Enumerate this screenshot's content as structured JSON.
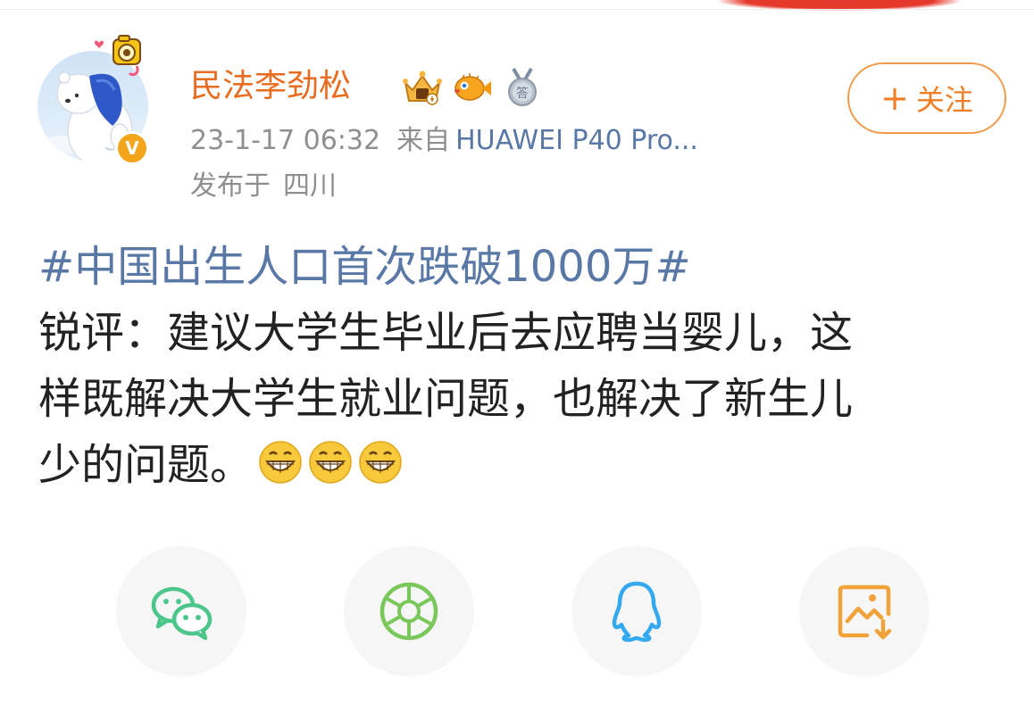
{
  "user": {
    "name": "民法李劲松",
    "verified_mark": "V",
    "badges": [
      "vip-crown-badge-icon",
      "pufferfish-badge-icon",
      "answer-medal-badge-icon"
    ]
  },
  "follow_button": {
    "plus": "+",
    "label": "关注"
  },
  "meta": {
    "timestamp": "23-1-17 06:32",
    "source_prefix": "来自",
    "source": "HUAWEI P40 Pro...",
    "location_label": "发布于",
    "location": "四川"
  },
  "post": {
    "hashtag": "#中国出生人口首次跌破1000万#",
    "lines": [
      "锐评：建议大学生毕业后去应聘当婴儿，这",
      "样既解决大学生就业问题，也解决了新生儿",
      "少的问题。"
    ],
    "emojis": [
      "grin-emoji-icon",
      "grin-emoji-icon",
      "grin-emoji-icon"
    ]
  },
  "share": {
    "items": [
      "wechat-icon",
      "moments-icon",
      "qq-icon",
      "save-image-icon"
    ],
    "colors": {
      "wechat": "#4cc68b",
      "moments": "#7ac75a",
      "qq": "#35a9f0",
      "save": "#f1a238"
    }
  },
  "colors": {
    "username": "#e86b1f",
    "link": "#5a78a6",
    "follow": "#ef7e25",
    "meta": "#8f8f8f"
  }
}
